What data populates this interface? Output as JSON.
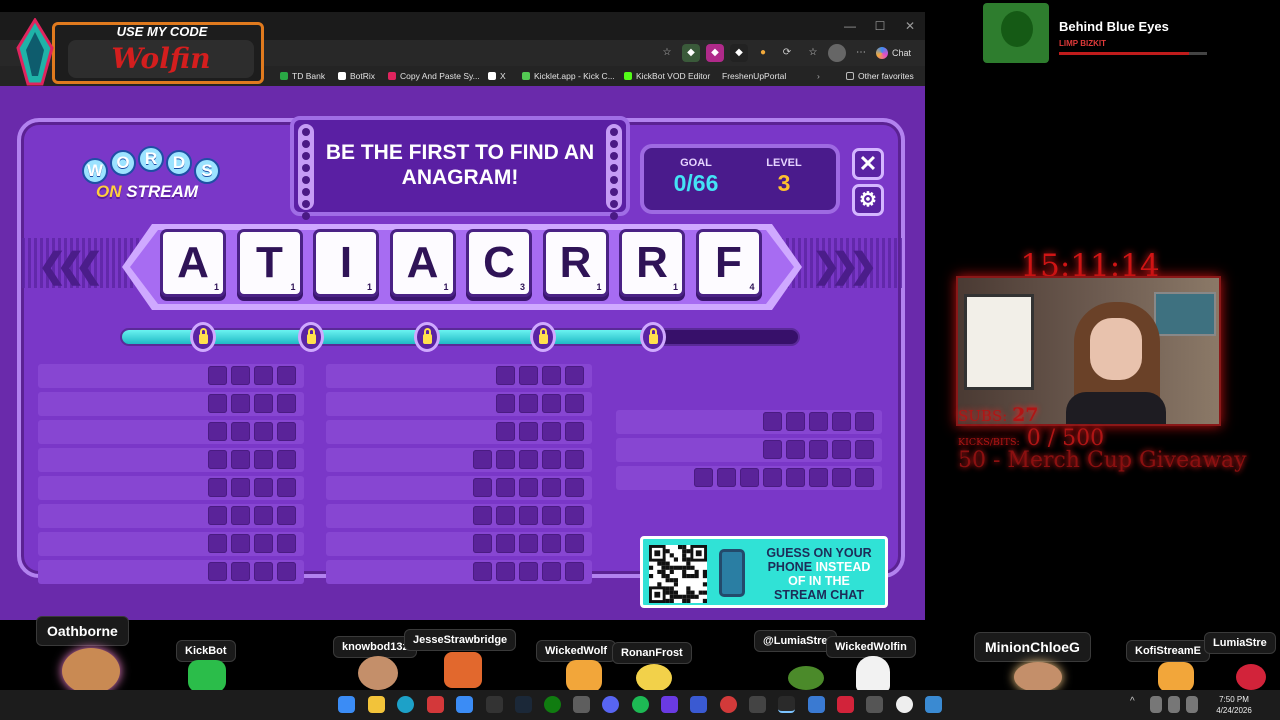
{
  "browser": {
    "toolbar_chat": "Chat",
    "bookmarks": [
      "TD Bank",
      "BotRix",
      "Copy And Paste Sy...",
      "X",
      "Kicklet.app - Kick C...",
      "KickBot VOD Editor",
      "FreshenUpPortal"
    ],
    "other_favorites": "Other favorites"
  },
  "promo": {
    "title": "USE MY CODE",
    "code": "Wolfin"
  },
  "game": {
    "logo_top": [
      "W",
      "O",
      "R",
      "D",
      "S"
    ],
    "logo_on": "ON",
    "logo_stream": "STREAM",
    "banner": "BE THE FIRST TO FIND AN ANAGRAM!",
    "goal_label": "GOAL",
    "goal_value": "0/66",
    "level_label": "LEVEL",
    "level_value": "3",
    "close_glyph": "✕",
    "settings_glyph": "⚙",
    "tiles": [
      {
        "letter": "A",
        "score": "1"
      },
      {
        "letter": "T",
        "score": "1"
      },
      {
        "letter": "I",
        "score": "1"
      },
      {
        "letter": "A",
        "score": "1"
      },
      {
        "letter": "C",
        "score": "3"
      },
      {
        "letter": "R",
        "score": "1"
      },
      {
        "letter": "R",
        "score": "1"
      },
      {
        "letter": "F",
        "score": "4"
      }
    ],
    "progress_fraction": 0.89,
    "lock_count": 5,
    "word_columns": [
      {
        "rows": [
          4,
          4,
          4,
          4,
          4,
          4,
          4,
          4
        ]
      },
      {
        "rows": [
          4,
          4,
          4,
          5,
          5,
          5,
          5,
          5
        ]
      },
      {
        "rows": [
          5,
          5,
          8
        ]
      }
    ],
    "qr_text_1": "GUESS ON YOUR",
    "qr_text_2": "PHONE",
    "qr_text_3": "INSTEAD",
    "qr_text_4": "OF IN THE",
    "qr_text_5": "STREAM CHAT"
  },
  "music": {
    "song": "Behind Blue Eyes",
    "artist": "LIMP BIZKIT"
  },
  "stream": {
    "timer": "15:11:14",
    "subs_label": "SUBS:",
    "subs_value": "27",
    "kicks_label": "KICKS/BITS:",
    "kicks_value": "0 / 500",
    "goal_line": "50 - Merch Cup Giveaway"
  },
  "chatters": [
    {
      "name": "Oathborne"
    },
    {
      "name": "KickBot"
    },
    {
      "name": "knowbod13z"
    },
    {
      "name": "JesseStrawbridge"
    },
    {
      "name": "WickedWolf"
    },
    {
      "name": "RonanFrost"
    },
    {
      "name": "@LumiaStre"
    },
    {
      "name": "WickedWolfin"
    },
    {
      "name": "MinionChloeG"
    },
    {
      "name": "KofiStreamE"
    },
    {
      "name": "LumiaStre"
    }
  ],
  "taskbar": {
    "time": "7:50 PM",
    "date": "4/24/2026"
  },
  "colors": {
    "game_bg": "#7a37c8",
    "accent_cyan": "#30e2d6",
    "stream_red": "#d01515"
  }
}
